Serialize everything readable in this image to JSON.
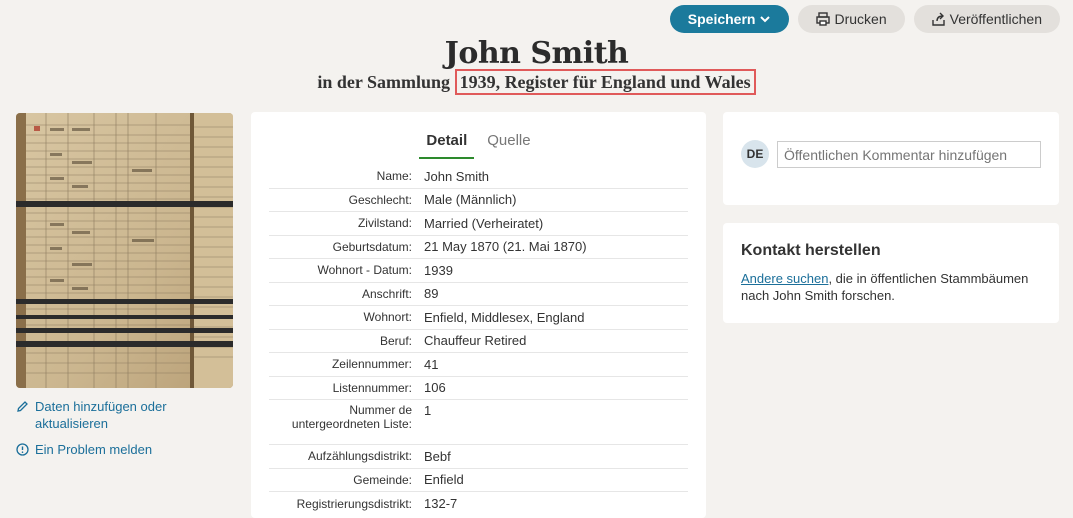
{
  "actions": {
    "save_label": "Speichern",
    "print_label": "Drucken",
    "publish_label": "Veröffentlichen"
  },
  "header": {
    "title": "John Smith",
    "subtitle_prefix": "in der Sammlung",
    "collection": "1939, Register für England und Wales"
  },
  "left": {
    "add_data_label": "Daten hinzufügen oder aktualisieren",
    "report_label": "Ein Problem melden"
  },
  "tabs": [
    {
      "label": "Detail",
      "active": true
    },
    {
      "label": "Quelle",
      "active": false
    }
  ],
  "fields": [
    {
      "label": "Name:",
      "value": "John Smith"
    },
    {
      "label": "Geschlecht:",
      "value": "Male (Männlich)"
    },
    {
      "label": "Zivilstand:",
      "value": "Married (Verheiratet)"
    },
    {
      "label": "Geburtsdatum:",
      "value": "21 May 1870 (21. Mai 1870)"
    },
    {
      "label": "Wohnort - Datum:",
      "value": "1939"
    },
    {
      "label": "Anschrift:",
      "value": "89"
    },
    {
      "label": "Wohnort:",
      "value": "Enfield, Middlesex, England"
    },
    {
      "label": "Beruf:",
      "value": "Chauffeur Retired"
    },
    {
      "label": "Zeilennummer:",
      "value": "41"
    },
    {
      "label": "Listennummer:",
      "value": "106"
    },
    {
      "label": "Nummer de untergeordneten Liste:",
      "value": "1"
    },
    {
      "label": "Aufzählungsdistrikt:",
      "value": "Bebf"
    },
    {
      "label": "Gemeinde:",
      "value": "Enfield"
    },
    {
      "label": "Registrierungsdistrikt:",
      "value": "132-7"
    }
  ],
  "comment": {
    "avatar_initials": "DE",
    "placeholder": "Öffentlichen Kommentar hinzufügen"
  },
  "contact": {
    "title": "Kontakt herstellen",
    "link_text": "Andere suchen",
    "text_after_link": ", die in öffentlichen Stammbäumen nach John Smith forschen."
  },
  "colors": {
    "primary": "#1b7a9c",
    "link": "#1b6f9a",
    "tab_underline": "#2d8a2d",
    "highlight_border": "#e05a5a",
    "background": "#f4f2ef"
  }
}
